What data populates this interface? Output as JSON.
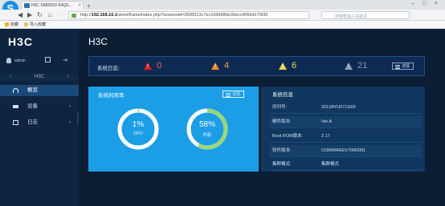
{
  "browser": {
    "tab_title": "H3C S5820V2-54QS...",
    "url_prefix": "http://",
    "url_host": "192.168.10.1",
    "url_path": "/wnm/frame/index.php?sessionid=2000013c7ec1069689e30ecc4064d170f35",
    "search_placeholder": "搜索框输入关键词",
    "favorites": [
      "收藏",
      "导入收藏"
    ]
  },
  "app": {
    "logo": "H3C",
    "page_title": "H3C",
    "user": "admin",
    "nav_header": "H3C",
    "menu": [
      {
        "label": "概览",
        "active": true
      },
      {
        "label": "设备",
        "active": false
      },
      {
        "label": "日志",
        "active": false
      }
    ]
  },
  "syslog": {
    "label": "系统日志:",
    "counts": [
      {
        "value": "0",
        "level": "critical",
        "color": "#e02020",
        "symbol": "!"
      },
      {
        "value": "4",
        "level": "major",
        "color": "#f08a24",
        "symbol": "!"
      },
      {
        "value": "6",
        "level": "minor",
        "color": "#e8d34a",
        "symbol": "!"
      },
      {
        "value": "21",
        "level": "info",
        "color": "#8a9aab",
        "symbol": "!"
      }
    ],
    "detail_button": "详情"
  },
  "usage": {
    "title": "系统利用率",
    "detail_button": "详情",
    "cpu": {
      "value": "1%",
      "label": "CPU",
      "fraction": 0.01
    },
    "mem": {
      "value": "58%",
      "label": "内存",
      "fraction": 0.58
    }
  },
  "sysinfo": {
    "title": "系统信息",
    "rows": [
      {
        "k": "序列号:",
        "v": "2013AYU0711t03"
      },
      {
        "k": "硬件版本:",
        "v": "Ver.A"
      },
      {
        "k": "Boot ROM版本:",
        "v": "2.17"
      },
      {
        "k": "软件版本:",
        "v": "COMWAREV700R001"
      },
      {
        "k": "集群模式:",
        "v": "集群模式"
      }
    ]
  }
}
